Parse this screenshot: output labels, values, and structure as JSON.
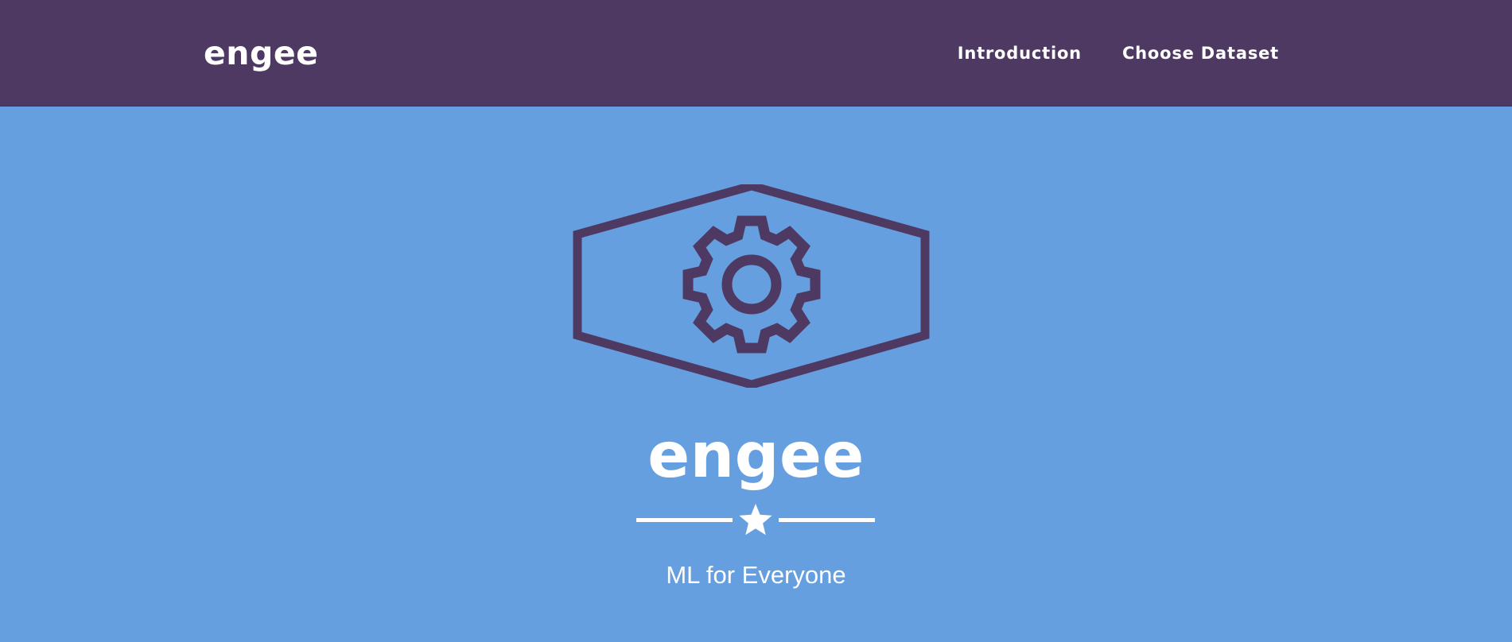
{
  "navbar": {
    "brand": "engee",
    "links": [
      {
        "label": "Introduction"
      },
      {
        "label": "Choose Dataset"
      }
    ]
  },
  "hero": {
    "logo_icon": "gear-in-hexagon-icon",
    "title": "engee",
    "divider_icon": "star-icon",
    "tagline": "ML for Everyone"
  },
  "colors": {
    "navbar_background": "#4e3962",
    "hero_background": "#669fdf",
    "logo_stroke": "#4e3962",
    "text": "#ffffff"
  }
}
